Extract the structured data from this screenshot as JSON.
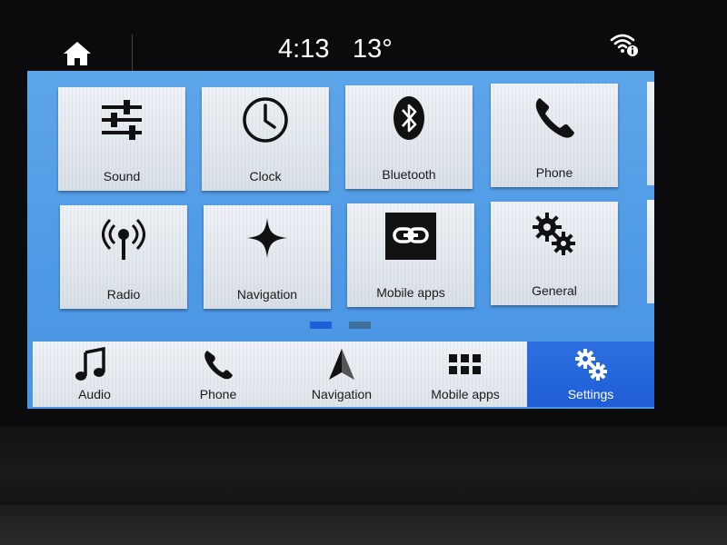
{
  "status": {
    "time": "4:13",
    "temperature": "13°",
    "home_icon": "home-icon",
    "wifi_icon": "wifi-info-icon"
  },
  "tiles": [
    {
      "label": "Sound",
      "icon": "sliders-icon"
    },
    {
      "label": "Clock",
      "icon": "clock-icon"
    },
    {
      "label": "Bluetooth",
      "icon": "bluetooth-icon"
    },
    {
      "label": "Phone",
      "icon": "phone-icon"
    },
    {
      "label": "Radio",
      "icon": "radio-antenna-icon"
    },
    {
      "label": "Navigation",
      "icon": "star-compass-icon"
    },
    {
      "label": "Mobile apps",
      "icon": "link-icon"
    },
    {
      "label": "General",
      "icon": "gears-icon"
    }
  ],
  "pagination": {
    "current": 1,
    "total": 2,
    "active_color": "#1f5ed6",
    "inactive_color": "#3d6f9a"
  },
  "navbar": [
    {
      "label": "Audio",
      "icon": "music-note-icon",
      "active": false
    },
    {
      "label": "Phone",
      "icon": "phone-icon",
      "active": false
    },
    {
      "label": "Navigation",
      "icon": "navigation-arrow-icon",
      "active": false
    },
    {
      "label": "Mobile apps",
      "icon": "app-grid-icon",
      "active": false
    },
    {
      "label": "Settings",
      "icon": "gears-icon",
      "active": true
    }
  ],
  "colors": {
    "screen_bg": "#5ea6ea",
    "active_nav": "#1f5ed6",
    "tile_bg": "#e6ebf0"
  }
}
